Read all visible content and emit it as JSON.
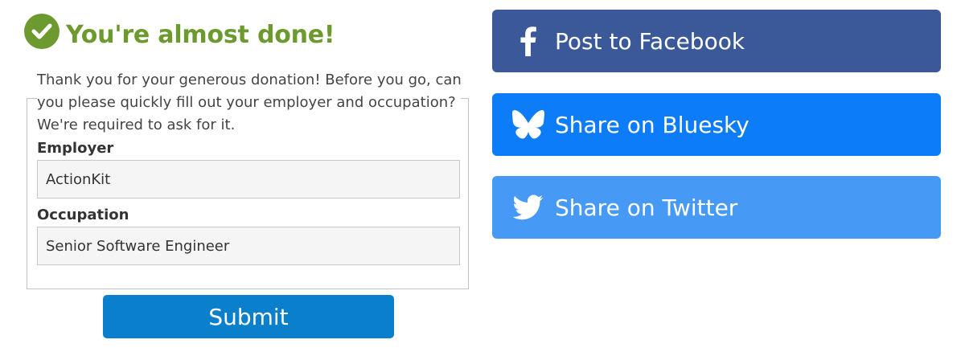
{
  "confirmation": {
    "heading": "You're almost done!",
    "intro_lines": [
      "Thank you for your generous donation! Before you go, can",
      "you please quickly fill out your employer and occupation?",
      "We're required to ask for it."
    ]
  },
  "form": {
    "employer": {
      "label": "Employer",
      "value": "ActionKit"
    },
    "occupation": {
      "label": "Occupation",
      "value": "Senior Software Engineer"
    },
    "submit_label": "Submit"
  },
  "share": {
    "facebook": {
      "label": "Post to Facebook",
      "icon": "facebook-icon",
      "color": "#3b5998"
    },
    "bluesky": {
      "label": "Share on Bluesky",
      "icon": "bluesky-butterfly-icon",
      "color": "#0c7cf8"
    },
    "twitter": {
      "label": "Share on Twitter",
      "icon": "twitter-bird-icon",
      "color": "#4699f5"
    }
  },
  "colors": {
    "heading_green": "#6c9a2f",
    "submit_blue": "#0a7fcc"
  }
}
